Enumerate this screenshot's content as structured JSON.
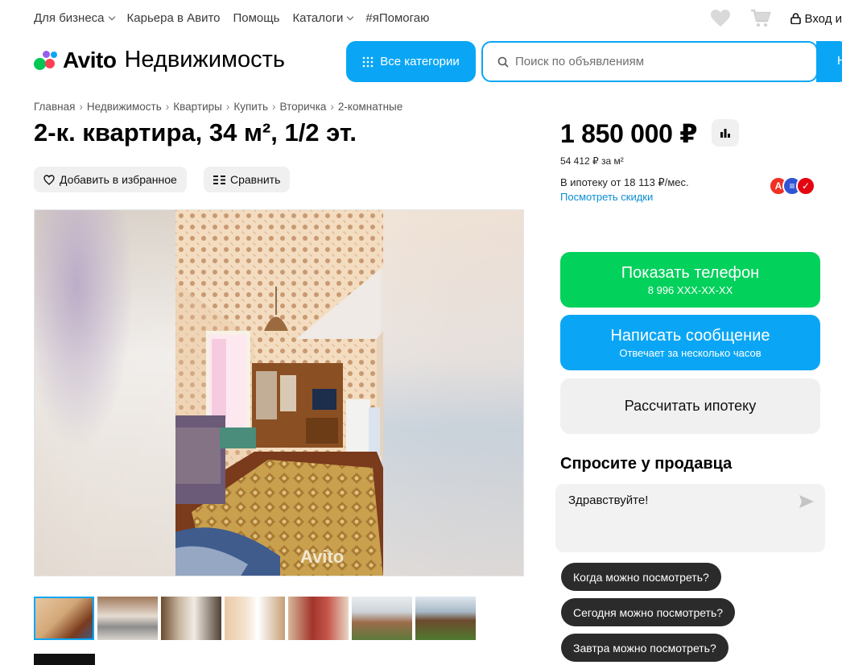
{
  "topnav": {
    "links": [
      "Для бизнеса",
      "Карьера в Авито",
      "Помощь",
      "Каталоги",
      "#яПомогаю"
    ],
    "login": "Вход и"
  },
  "header": {
    "brand": "Avito",
    "section": "Недвижимость",
    "categories_button": "Все категории",
    "search_placeholder": "Поиск по объявлениям",
    "find_button": "Н"
  },
  "breadcrumb": [
    "Главная",
    "Недвижимость",
    "Квартиры",
    "Купить",
    "Вторичка",
    "2-комнатные"
  ],
  "listing": {
    "title": "2-к. квартира, 34 м², 1/2 эт.",
    "favorite": "Добавить в избранное",
    "compare": "Сравнить",
    "watermark": "Avito",
    "thumbnail_count": 7
  },
  "price": {
    "value": "1 850 000 ₽",
    "per_meter": "54 412 ₽ за м²",
    "mortgage": "В ипотеку от 18 113 ₽/мес.",
    "discounts": "Посмотреть скидки"
  },
  "banks": [
    {
      "letter": "А",
      "color": "#ef3124"
    },
    {
      "letter": "≡",
      "color": "#2f55d4"
    },
    {
      "letter": "✓",
      "color": "#e30611"
    }
  ],
  "buttons": {
    "phone_label": "Показать телефон",
    "phone_number": "8 996 XXX-XX-XX",
    "message_label": "Написать сообщение",
    "message_sub": "Отвечает за несколько часов",
    "mortgage_label": "Рассчитать ипотеку"
  },
  "ask": {
    "title": "Спросите у продавца",
    "message": "Здравствуйте!",
    "chips": [
      "Когда можно посмотреть?",
      "Сегодня можно посмотреть?",
      "Завтра можно посмотреть?"
    ]
  },
  "colors": {
    "accent": "#0aa6f5",
    "green": "#02d15c",
    "chip": "#2b2b2b"
  }
}
